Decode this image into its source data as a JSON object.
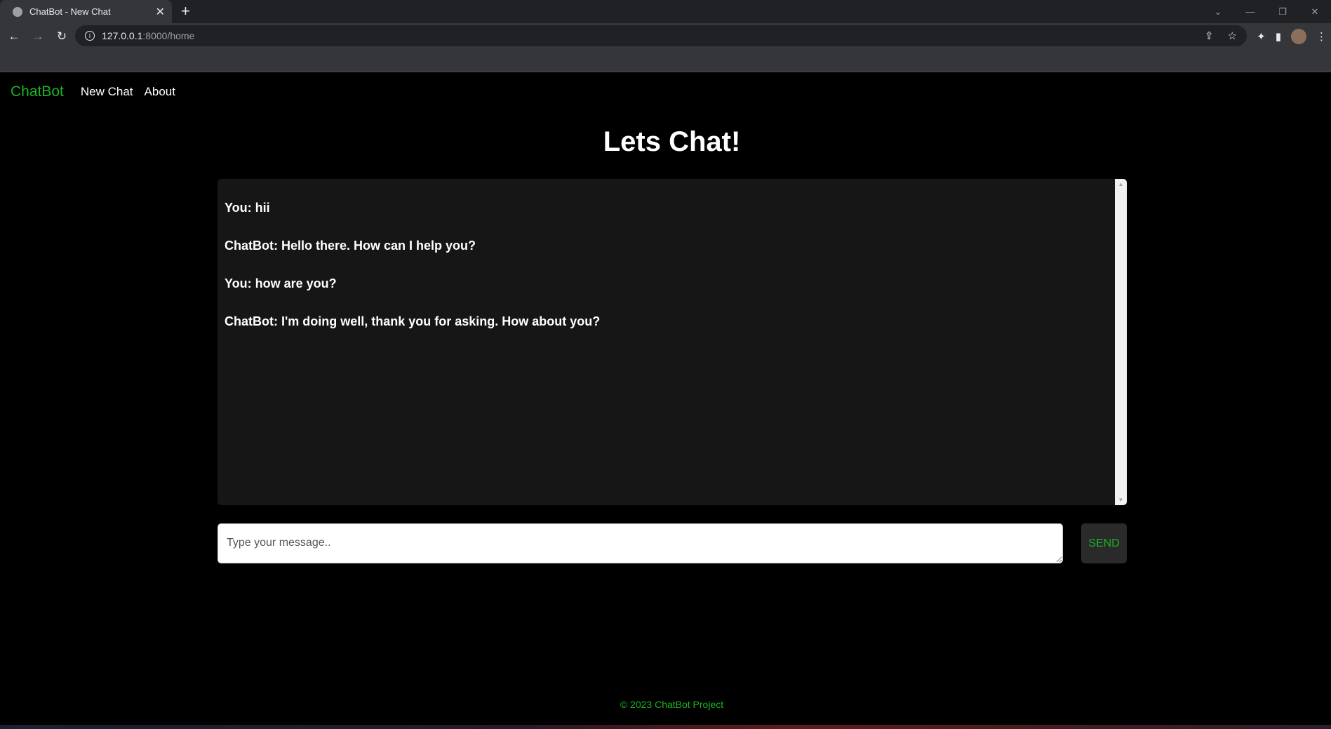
{
  "browser": {
    "tab_title": "ChatBot - New Chat",
    "tab_close": "✕",
    "new_tab": "+",
    "url_host": "127.0.0.1",
    "url_rest": ":8000/home"
  },
  "navbar": {
    "brand": "ChatBot",
    "links": [
      "New Chat",
      "About"
    ]
  },
  "page": {
    "title": "Lets Chat!"
  },
  "chat": {
    "messages": [
      "You: hii",
      "ChatBot: Hello there. How can I help you?",
      "You: how are you?",
      "ChatBot: I'm doing well, thank you for asking. How about you?"
    ]
  },
  "composer": {
    "placeholder": "Type your message..",
    "send_label": "SEND"
  },
  "footer": {
    "text": "© 2023 ChatBot Project"
  },
  "colors": {
    "accent": "#1db324",
    "background": "#000000",
    "chat_box": "#161616"
  }
}
